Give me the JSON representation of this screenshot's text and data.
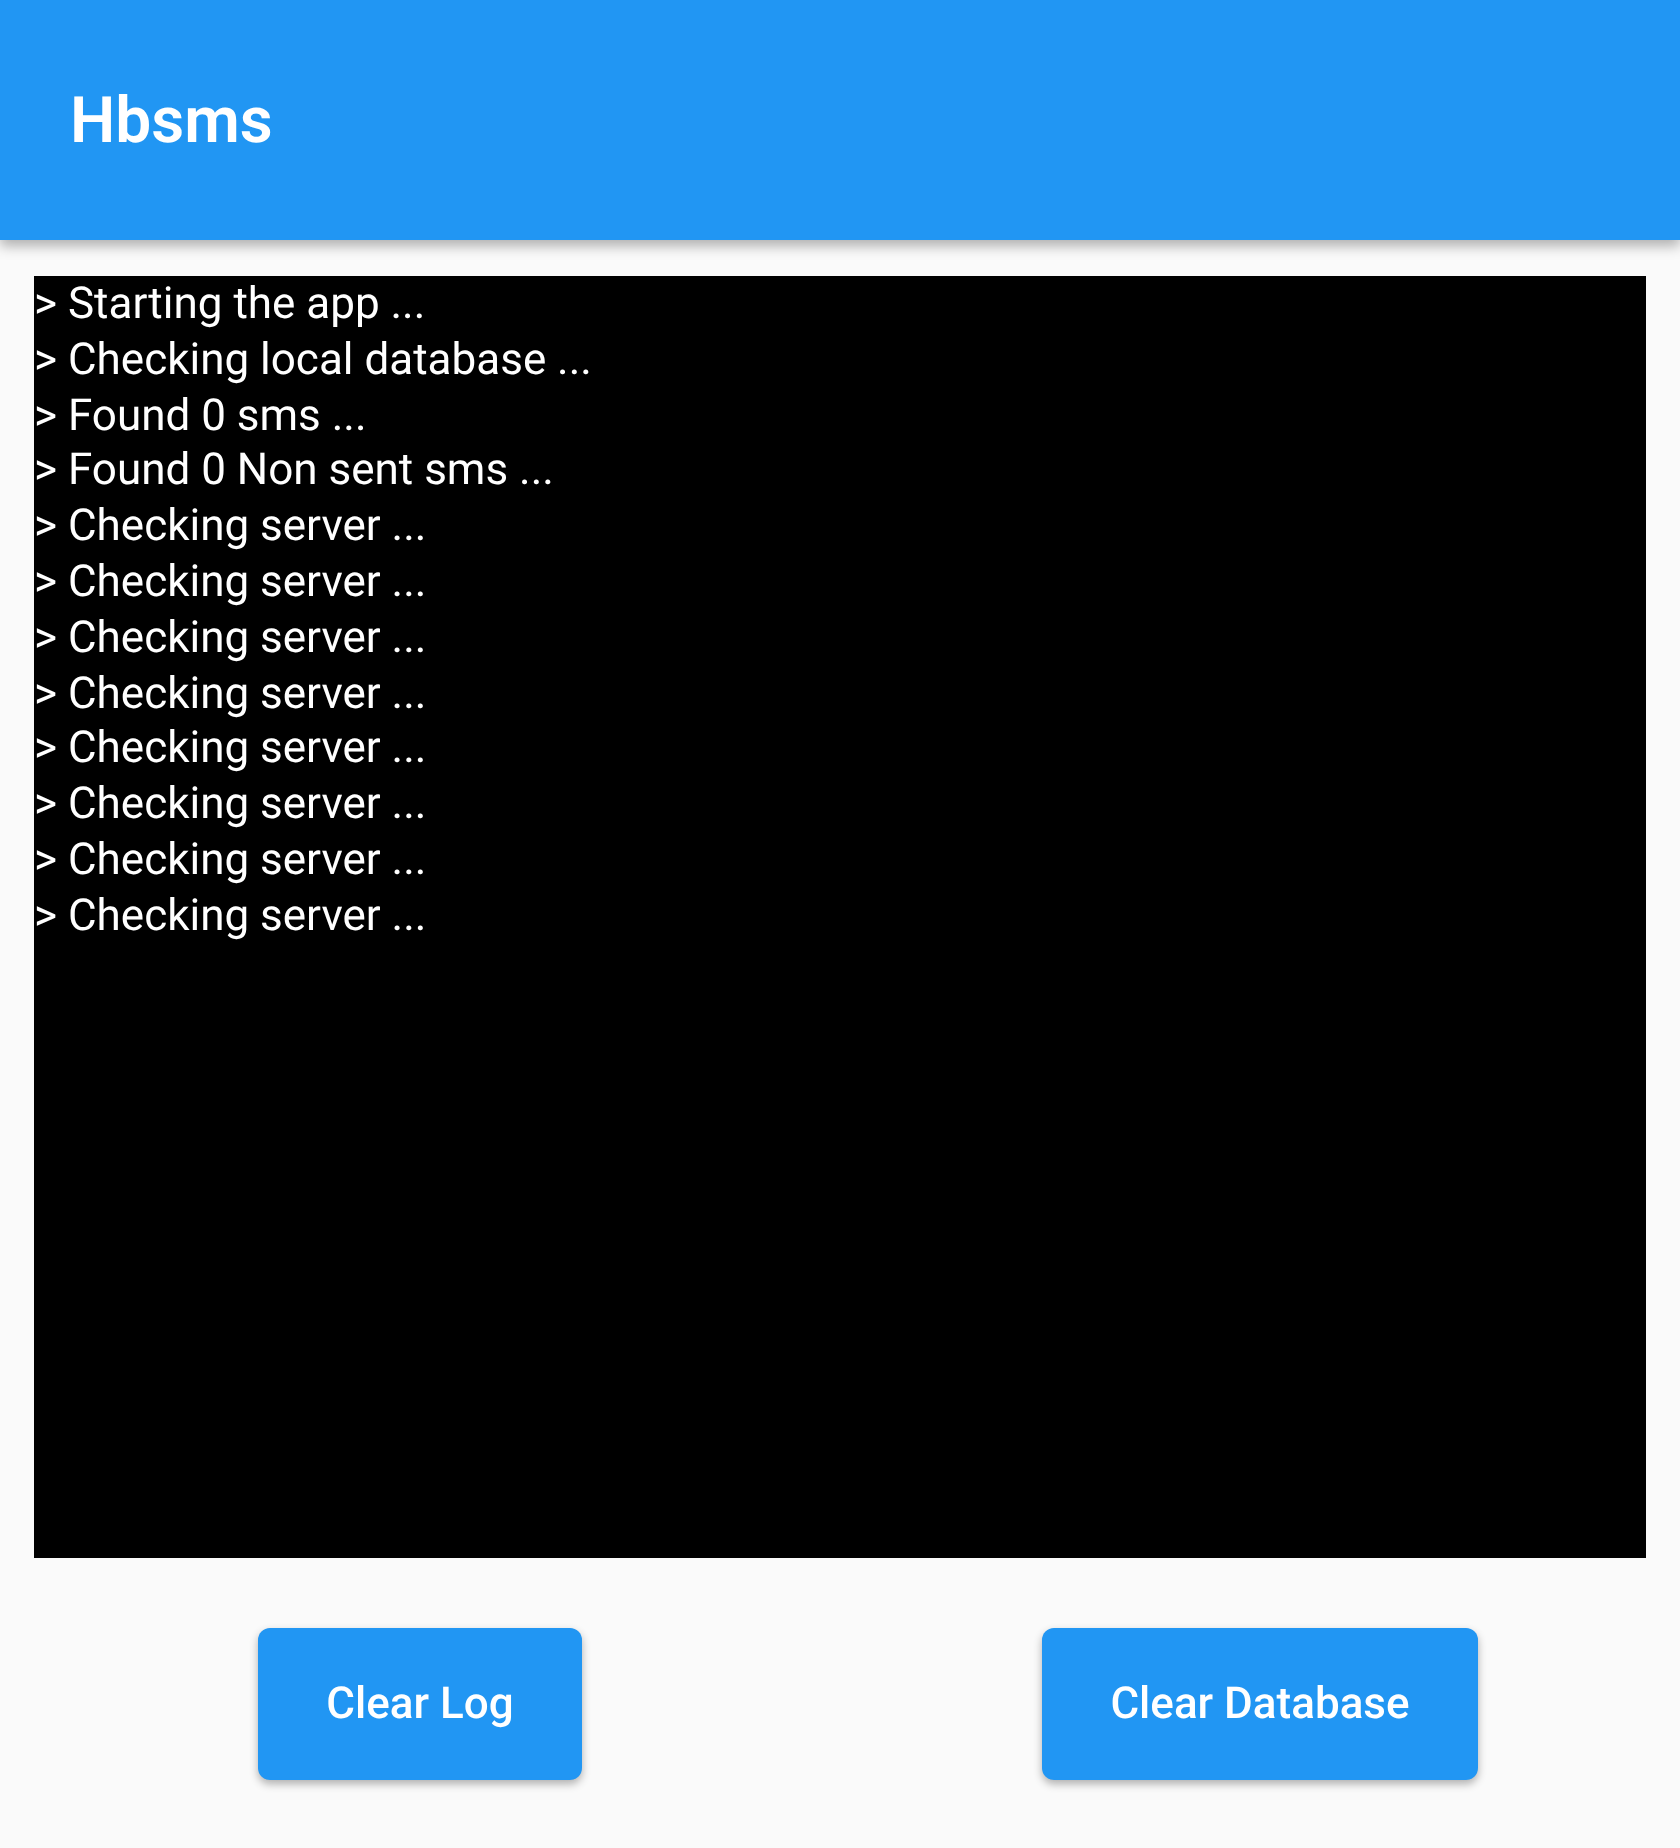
{
  "app_bar": {
    "title": "Hbsms"
  },
  "log": {
    "lines": [
      "> Starting the app ...",
      "> Checking local database ...",
      "> Found 0 sms ...",
      "> Found 0 Non sent sms ...",
      "> Checking server ...",
      "> Checking server ...",
      "> Checking server ...",
      "> Checking server ...",
      "> Checking server ...",
      "> Checking server ...",
      "> Checking server ...",
      "> Checking server ..."
    ]
  },
  "buttons": [
    "Clear Log",
    "Clear Database"
  ]
}
